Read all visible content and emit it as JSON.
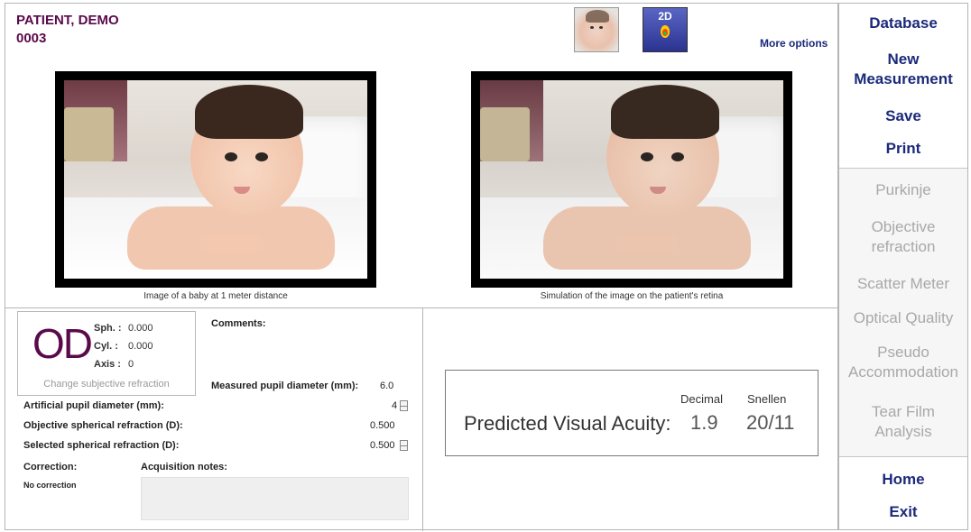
{
  "patient": {
    "name": "PATIENT, DEMO",
    "id": "0003"
  },
  "header": {
    "thumb_2d_label": "2D",
    "more_options": "More options"
  },
  "images": {
    "left_caption": "Image of a baby at 1 meter distance",
    "right_caption": "Simulation of the image on the patient's retina"
  },
  "refraction": {
    "eye": "OD",
    "sph_label": "Sph. :",
    "sph_value": "0.000",
    "cyl_label": "Cyl. :",
    "cyl_value": "0.000",
    "axis_label": "Axis :",
    "axis_value": "0",
    "change_label": "Change subjective refraction"
  },
  "comments_label": "Comments:",
  "measured_pupil": {
    "label": "Measured pupil diameter (mm):",
    "value": "6.0"
  },
  "artificial_pupil": {
    "label": "Artificial pupil diameter (mm):",
    "value": "4"
  },
  "objective_sph": {
    "label": "Objective spherical refraction (D):",
    "value": "0.500"
  },
  "selected_sph": {
    "label": "Selected spherical refraction (D):",
    "value": "0.500"
  },
  "correction": {
    "label": "Correction:",
    "value": "No correction"
  },
  "acquisition_notes_label": "Acquisition notes:",
  "acuity": {
    "label": "Predicted Visual Acuity:",
    "decimal_header": "Decimal",
    "snellen_header": "Snellen",
    "decimal_value": "1.9",
    "snellen_value": "20/11"
  },
  "sidebar": {
    "database": "Database",
    "new_measurement_1": "New",
    "new_measurement_2": "Measurement",
    "save": "Save",
    "print": "Print",
    "purkinje": "Purkinje",
    "objective_1": "Objective",
    "objective_2": "refraction",
    "scatter": "Scatter Meter",
    "optical_quality": "Optical Quality",
    "pseudo_1": "Pseudo",
    "pseudo_2": "Accommodation",
    "tear_1": "Tear Film",
    "tear_2": "Analysis",
    "home": "Home",
    "exit": "Exit"
  },
  "colors": {
    "brand": "#5a0a4a",
    "accent": "#1b2a7a",
    "disabled": "#a8a8a8"
  }
}
